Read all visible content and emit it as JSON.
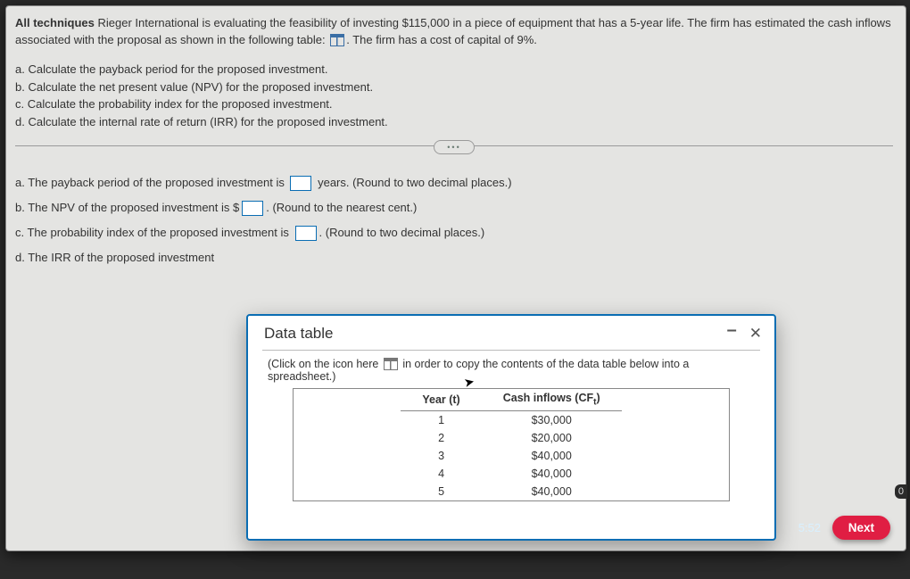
{
  "intro": {
    "bold": "All techniques",
    "part1": "Rieger International is evaluating the feasibility of investing $115,000 in a piece of equipment that has a 5-year life. The firm has estimated the cash inflows associated with the proposal as shown in the following table:",
    "part2": ". The firm has a cost of capital of 9%."
  },
  "questions": {
    "a": "a.  Calculate the payback period for the proposed investment.",
    "b": "b.  Calculate the  net present value (NPV) for the proposed investment.",
    "c": "c.  Calculate the probability index for the proposed investment.",
    "d": "d.  Calculate the internal rate of return (IRR) for the proposed investment."
  },
  "divider_label": "•••",
  "answers": {
    "a_pre": "a. The payback period of the proposed investment is",
    "a_post": " years.  (Round to two decimal places.)",
    "b_pre": "b. The NPV of the proposed investment is $",
    "b_post": ".  (Round to the nearest cent.)",
    "c_pre": "c. The probability index of the proposed investment is",
    "c_post": ".  (Round to two decimal places.)",
    "d_pre": "d. The IRR of the proposed investment"
  },
  "modal": {
    "title": "Data table",
    "hint_pre": "(Click on the icon here ",
    "hint_post": " in order to copy the contents of the data table below into a spreadsheet.)",
    "col1": "Year (t)",
    "col2_pre": "Cash inflows (CF",
    "col2_sub": "t",
    "col2_post": ")",
    "rows": [
      {
        "year": "1",
        "cf": "$30,000"
      },
      {
        "year": "2",
        "cf": "$20,000"
      },
      {
        "year": "3",
        "cf": "$40,000"
      },
      {
        "year": "4",
        "cf": "$40,000"
      },
      {
        "year": "5",
        "cf": "$40,000"
      }
    ]
  },
  "clock": "5:52",
  "next": "Next",
  "badge0": "0"
}
